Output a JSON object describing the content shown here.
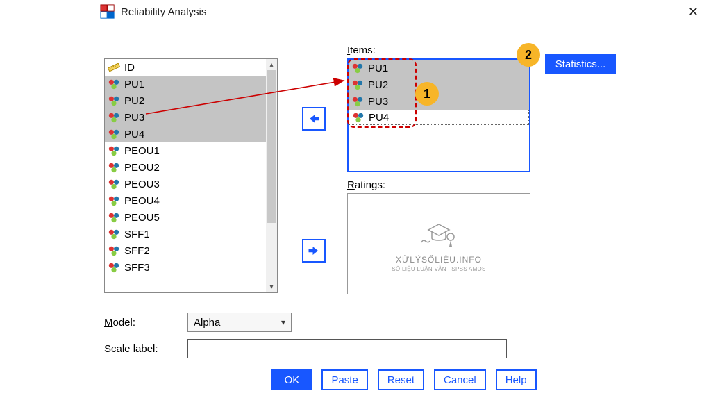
{
  "window": {
    "title": "Reliability Analysis"
  },
  "labels": {
    "items": "Items:",
    "ratings": "Ratings:",
    "model": "Model:",
    "scale": "Scale label:"
  },
  "source_list": [
    {
      "name": "ID",
      "icon": "ruler",
      "selected": false
    },
    {
      "name": "PU1",
      "icon": "nominal",
      "selected": true
    },
    {
      "name": "PU2",
      "icon": "nominal",
      "selected": true
    },
    {
      "name": "PU3",
      "icon": "nominal",
      "selected": true
    },
    {
      "name": "PU4",
      "icon": "nominal",
      "selected": true
    },
    {
      "name": "PEOU1",
      "icon": "nominal",
      "selected": false
    },
    {
      "name": "PEOU2",
      "icon": "nominal",
      "selected": false
    },
    {
      "name": "PEOU3",
      "icon": "nominal",
      "selected": false
    },
    {
      "name": "PEOU4",
      "icon": "nominal",
      "selected": false
    },
    {
      "name": "PEOU5",
      "icon": "nominal",
      "selected": false
    },
    {
      "name": "SFF1",
      "icon": "nominal",
      "selected": false
    },
    {
      "name": "SFF2",
      "icon": "nominal",
      "selected": false
    },
    {
      "name": "SFF3",
      "icon": "nominal",
      "selected": false
    }
  ],
  "items_list": [
    {
      "name": "PU1",
      "selected": true
    },
    {
      "name": "PU2",
      "selected": true
    },
    {
      "name": "PU3",
      "selected": true
    },
    {
      "name": "PU4",
      "selected": false
    }
  ],
  "model": {
    "selected": "Alpha"
  },
  "scale_input": {
    "value": ""
  },
  "buttons": {
    "statistics": "Statistics...",
    "ok": "OK",
    "paste": "Paste",
    "reset": "Reset",
    "cancel": "Cancel",
    "help": "Help"
  },
  "annotations": {
    "callout1": "1",
    "callout2": "2"
  },
  "watermark": {
    "title": "XỬLÝSỐLIỆU.INFO",
    "subtitle": "SỐ LIỆU LUẬN VĂN | SPSS AMOS"
  }
}
